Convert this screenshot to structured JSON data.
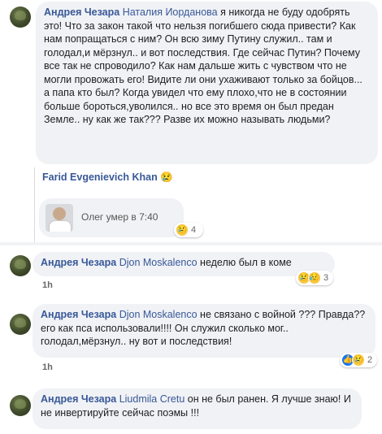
{
  "comments": [
    {
      "author": "Андрея Чезара",
      "tag": "Наталия Иорданова",
      "text": " я никогда не буду одобрять это! Что за закон такой что нельзя погибшего сюда привести? Как нам попращаться с ним? Он всю зиму Путину служил.. там и голодал,и мёрзнул.. и вот последствия. Где сейчас Путин? Почему все так не спроводило? Как нам дальше жить с чувством что не могли провожать его! Видите ли они ухаживают только за бойцов... а папа кто был? Когда увидел что ему плохо,что не в состоянии больше бороться,уволился.. но все это время он был предан Земле.. ну как же так??? Разве их можно называть людьми?"
    },
    {
      "author": "Андрея Чезара",
      "tag": "Djon Moskalenco",
      "text": " неделю был в коме",
      "time": "1h",
      "reactions": {
        "icons": [
          "sad",
          "sad2"
        ],
        "count": "3"
      }
    },
    {
      "author": "Андрея Чезара",
      "tag": "Djon Moskalenco",
      "text": " не связано с войной ??? Правда?? его как пса использовали!!!! Он служил сколько мог.. голодал,мёрзнул.. ну вот и последствия!",
      "time": "1h",
      "reactions": {
        "icons": [
          "like",
          "sad"
        ],
        "count": "2"
      }
    },
    {
      "author": "Андрея Чезара",
      "tag": "Liudmila Cretu",
      "text": " он не был ранен. Я лучше знаю! И не инвертируйте сейчас поэмы !!!"
    }
  ],
  "reply": {
    "author": "Farid Evgenievich Khan",
    "emoji": "😢",
    "inner_text": "Олег умер в 7:40",
    "reactions": {
      "icons": [
        "sad"
      ],
      "count": "4"
    }
  },
  "icons": {
    "sad": "😢",
    "sad2": "😥",
    "like": "👍"
  },
  "colors": {
    "link": "#385898",
    "bubble": "#f0f2f5",
    "meta": "#65676b"
  }
}
